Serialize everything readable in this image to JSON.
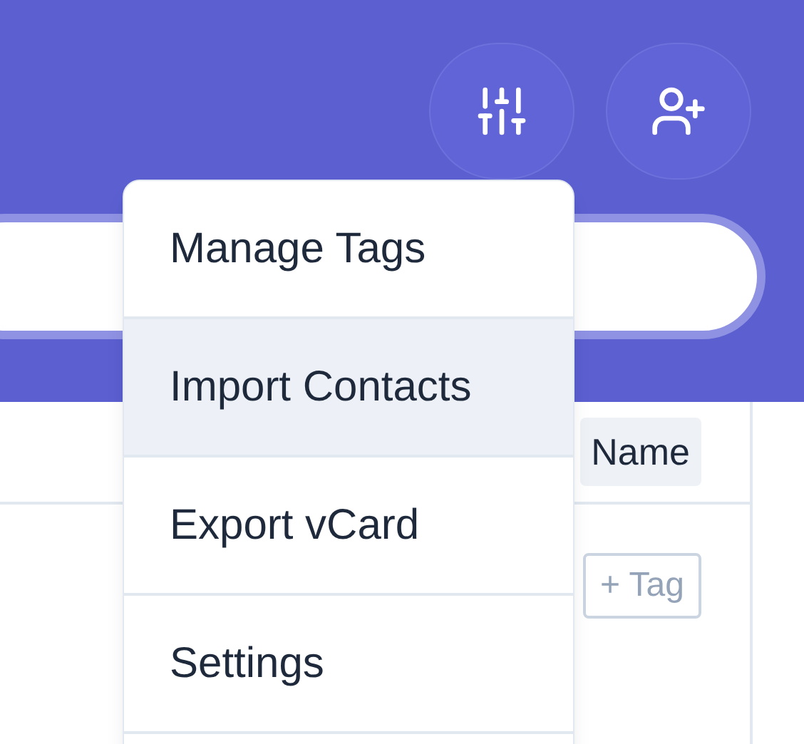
{
  "header": {
    "buttons": [
      {
        "kind": "filters"
      },
      {
        "kind": "add-contact"
      }
    ]
  },
  "table": {
    "columns": [
      "Name"
    ],
    "rows": [
      {
        "tag_button": "+ Tag"
      }
    ]
  },
  "menu": {
    "items": [
      {
        "label": "Manage Tags",
        "selected": false
      },
      {
        "label": "Import Contacts",
        "selected": true
      },
      {
        "label": "Export vCard",
        "selected": false
      },
      {
        "label": "Settings",
        "selected": false
      }
    ]
  }
}
